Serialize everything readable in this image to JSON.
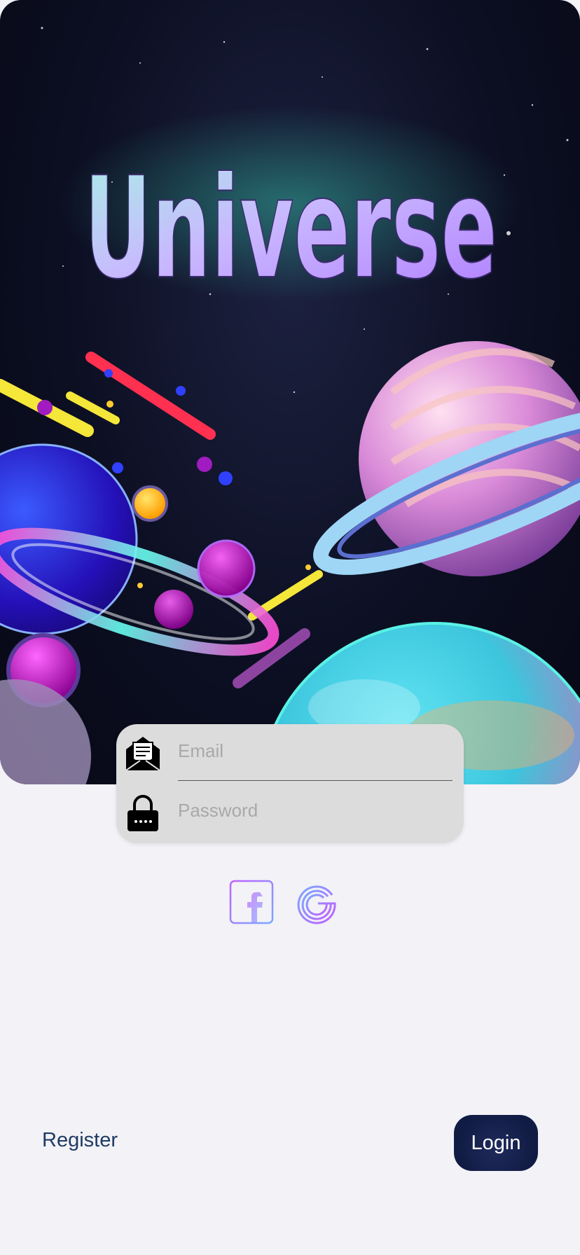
{
  "hero": {
    "title": "Universe",
    "background_color": "#0c0f22"
  },
  "form": {
    "email": {
      "placeholder": "Email",
      "value": "",
      "icon": "envelope-icon"
    },
    "password": {
      "placeholder": "Password",
      "value": "",
      "icon": "padlock-icon"
    }
  },
  "social": {
    "facebook_icon": "facebook-icon",
    "google_icon": "google-icon"
  },
  "actions": {
    "register_label": "Register",
    "login_label": "Login"
  },
  "colors": {
    "page_background": "#f2f2f7",
    "card_background": "#dcdcdc",
    "link_color": "#1f3b63",
    "button_background": "#111c44",
    "social_gradient_start": "#c061ff",
    "social_gradient_end": "#7aa8ff"
  }
}
